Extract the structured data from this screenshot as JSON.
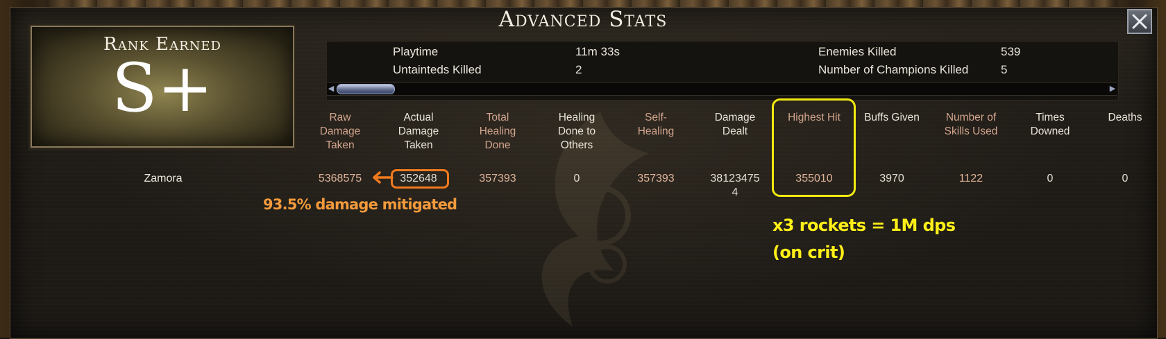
{
  "window": {
    "title": "Advanced Stats"
  },
  "rank": {
    "label": "Rank Earned",
    "value": "S+"
  },
  "summary": {
    "playtime_label": "Playtime",
    "playtime_value": "11m 33s",
    "untainteds_label": "Untainteds Killed",
    "untainteds_value": "2",
    "enemies_label": "Enemies Killed",
    "enemies_value": "539",
    "champions_label": "Number of Champions Killed",
    "champions_value": "5"
  },
  "columns": [
    [
      "Raw",
      "Damage",
      "Taken"
    ],
    [
      "Actual",
      "Damage",
      "Taken"
    ],
    [
      "Total",
      "Healing",
      "Done"
    ],
    [
      "Healing",
      "Done to",
      "Others"
    ],
    [
      "Self-",
      "Healing"
    ],
    [
      "Damage",
      "Dealt"
    ],
    [
      "Highest Hit"
    ],
    [
      "Buffs Given"
    ],
    [
      "Number of",
      "Skills Used"
    ],
    [
      "Times",
      "Downed"
    ],
    [
      "Deaths"
    ]
  ],
  "player": {
    "name": "Zamora",
    "values": [
      "5368575",
      "352648",
      "357393",
      "0",
      "357393",
      "38123475",
      "355010",
      "3970",
      "1122",
      "0",
      "0"
    ],
    "damage_dealt_wrap": "4"
  },
  "annotations": {
    "mitigated": "93.5% damage mitigated",
    "rockets_line1": "x3 rockets = 1M dps",
    "rockets_line2": "(on crit)"
  },
  "colors": {
    "header_text": "#c8a58a",
    "annotation_orange": "#f39a3c",
    "annotation_yellow": "#ffef18"
  }
}
